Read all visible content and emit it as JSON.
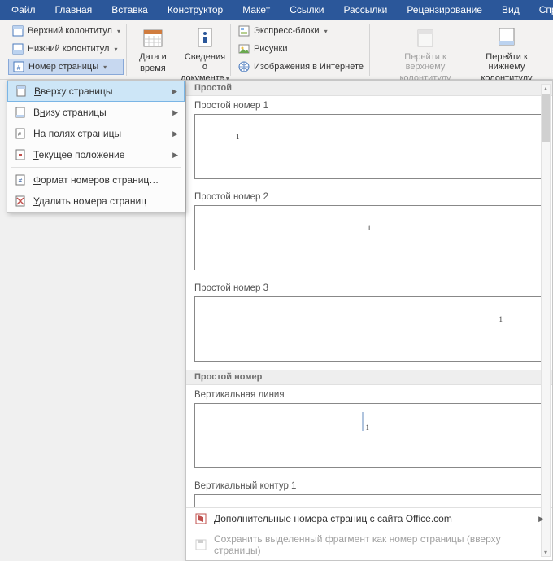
{
  "menubar": [
    "Файл",
    "Главная",
    "Вставка",
    "Конструктор",
    "Макет",
    "Ссылки",
    "Рассылки",
    "Рецензирование",
    "Вид",
    "Спр"
  ],
  "ribbon": {
    "headerFooter": {
      "top": "Верхний колонтитул",
      "bottom": "Нижний колонтитул",
      "pageNum": "Номер страницы"
    },
    "dateTime": {
      "l1": "Дата и",
      "l2": "время"
    },
    "docInfo": {
      "l1": "Сведения о",
      "l2": "документе"
    },
    "blocks": {
      "express": "Экспресс-блоки",
      "pictures": "Рисунки",
      "webImages": "Изображения в Интернете"
    },
    "navTop": {
      "l1": "Перейти к верхнему",
      "l2": "колонтитулу"
    },
    "navBottom": {
      "l1": "Перейти к нижнему",
      "l2": "колонтитулу"
    }
  },
  "ctx": {
    "top": "Вверху страницы",
    "bottom": "Внизу страницы",
    "margins": "На полях страницы",
    "current": "Текущее положение",
    "format": "Формат номеров страниц…",
    "remove": "Удалить номера страниц"
  },
  "gallery": {
    "cat1": "Простой",
    "i1": "Простой номер 1",
    "i2": "Простой номер 2",
    "i3": "Простой номер 3",
    "cat2": "Простой номер",
    "i4": "Вертикальная линия",
    "i5": "Вертикальный контур 1",
    "more": "Дополнительные номера страниц с сайта Office.com",
    "save": "Сохранить выделенный фрагмент как номер страницы (вверху страницы)"
  }
}
